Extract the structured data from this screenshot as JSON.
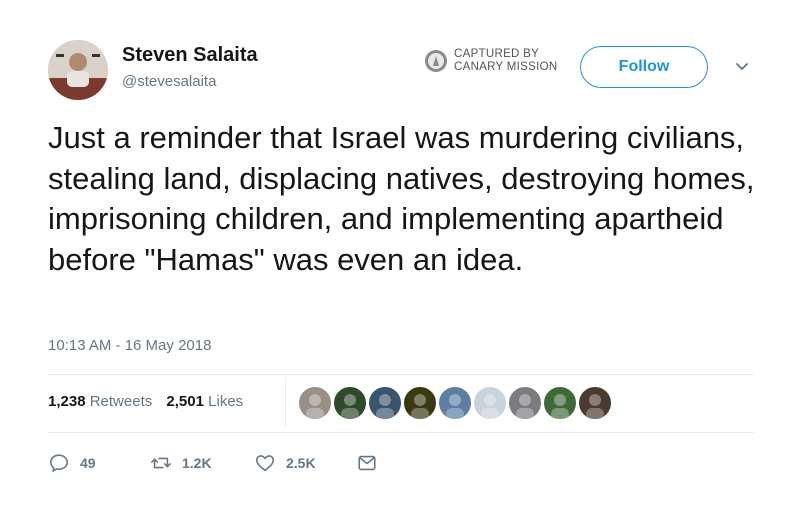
{
  "author": {
    "display_name": "Steven Salaita",
    "handle": "@stevesalaita"
  },
  "watermark": {
    "line1": "CAPTURED BY",
    "line2": "CANARY MISSION"
  },
  "follow_label": "Follow",
  "tweet": {
    "text": "Just a reminder that Israel was murdering civilians, stealing land, displacing natives, destroying homes, imprisoning children, and implementing apartheid before \"Hamas\" was even an idea.",
    "timestamp": "10:13 AM - 16 May 2018"
  },
  "stats": {
    "retweets_count": "1,238",
    "retweets_label": "Retweets",
    "likes_count": "2,501",
    "likes_label": "Likes"
  },
  "liker_avatars": [
    {
      "name": "avatar-1",
      "color": "#9a8f86"
    },
    {
      "name": "avatar-2",
      "color": "#2f4a2a"
    },
    {
      "name": "avatar-3",
      "color": "#3a556e"
    },
    {
      "name": "avatar-4",
      "color": "#3a3a12"
    },
    {
      "name": "avatar-5",
      "color": "#5b7ea3"
    },
    {
      "name": "avatar-6",
      "color": "#c8d3dc"
    },
    {
      "name": "avatar-7",
      "color": "#7a7c80"
    },
    {
      "name": "avatar-8",
      "color": "#3f6a35"
    },
    {
      "name": "avatar-9",
      "color": "#4a3a2f"
    }
  ],
  "actions": {
    "replies": "49",
    "retweets": "1.2K",
    "likes": "2.5K"
  },
  "colors": {
    "accent": "#1b95e0",
    "secondary_text": "#657786",
    "divider": "#e6ecf0"
  }
}
